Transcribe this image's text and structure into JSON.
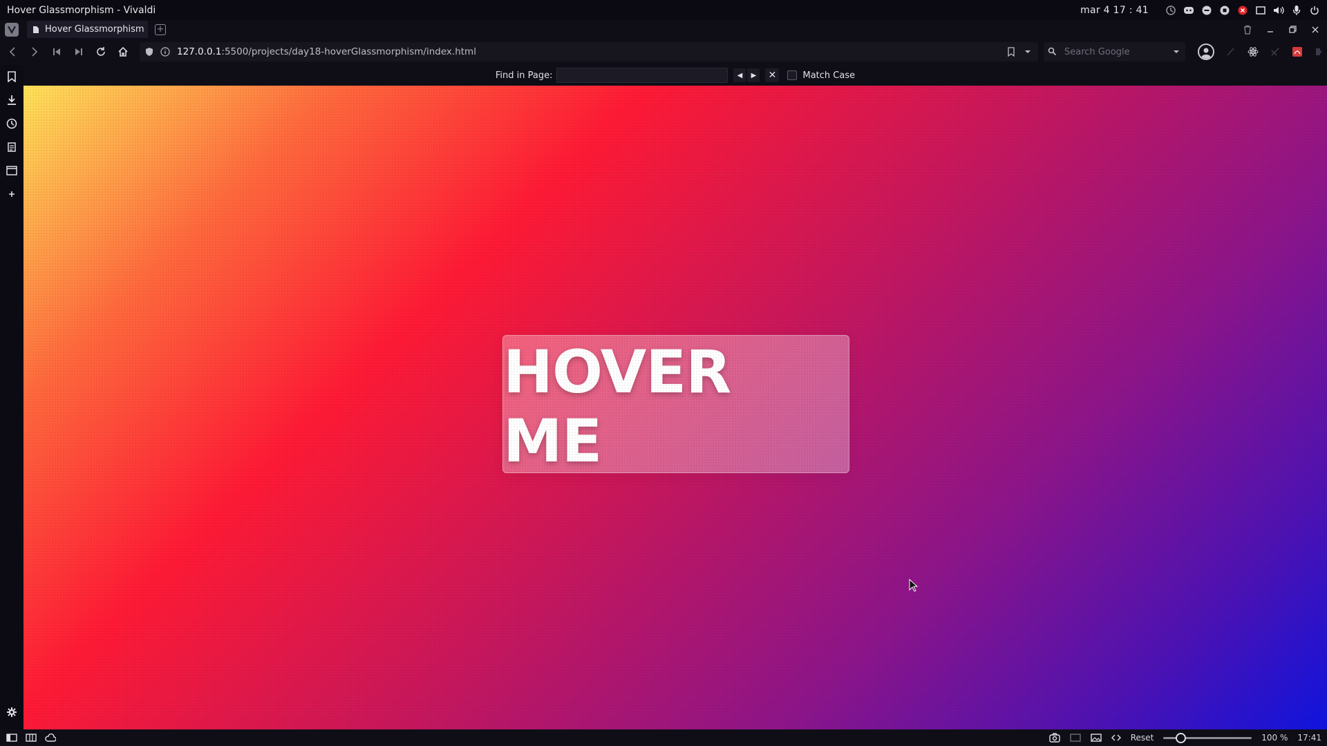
{
  "os_bar": {
    "window_title": "Hover Glassmorphism - Vivaldi",
    "date_time": "mar 4  17 : 41",
    "icons": [
      "update-icon",
      "discord-icon",
      "minimize-circle-icon",
      "record-icon",
      "close-circle-icon",
      "window-icon",
      "volume-icon",
      "microphone-icon",
      "power-icon"
    ]
  },
  "tab_bar": {
    "tabs": [
      {
        "label": "Hover Glassmorphism",
        "active": true
      }
    ],
    "icons": [
      "vivaldi-menu-icon",
      "new-tab-icon",
      "trash-icon",
      "minimize-icon",
      "restore-icon",
      "close-icon"
    ]
  },
  "address_bar": {
    "url_host": "127.0.0.1",
    "url_path": ":5500/projects/day18-hoverGlassmorphism/index.html",
    "search_placeholder": "Search Google"
  },
  "find_bar": {
    "label": "Find in Page:",
    "query": "",
    "match_case_label": "Match Case",
    "match_case_checked": false
  },
  "side_panel": {
    "items": [
      "bookmarks-icon",
      "downloads-icon",
      "history-icon",
      "notes-icon",
      "window-panel-icon",
      "add-panel-icon"
    ],
    "settings": "settings-icon"
  },
  "page": {
    "button_text": "HOVER ME",
    "gradient_colors": [
      "#ffe259",
      "#ff1a35",
      "#c8175c",
      "#8d158a",
      "#0f14e0"
    ]
  },
  "status_bar": {
    "reset_label": "Reset",
    "zoom_value": "100 %",
    "zoom_fraction": 0.2,
    "clock": "17:41"
  }
}
